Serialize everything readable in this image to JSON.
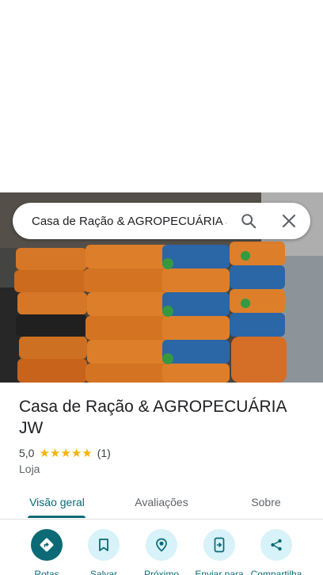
{
  "search": {
    "query": "Casa de Ração & AGROPECUÁRIA JW",
    "search_icon": "search-icon",
    "close_icon": "close-icon"
  },
  "photo": {
    "description_icon": "place-photo"
  },
  "place": {
    "name": "Casa de Ração & AGROPECUÁRIA JW",
    "rating": "5,0",
    "stars": 5,
    "review_count": "(1)",
    "category": "Loja"
  },
  "tabs": [
    {
      "label": "Visão geral",
      "active": true
    },
    {
      "label": "Avaliações",
      "active": false
    },
    {
      "label": "Sobre",
      "active": false
    }
  ],
  "actions": [
    {
      "label": "Rotas",
      "icon": "directions-icon"
    },
    {
      "label": "Salvar",
      "icon": "bookmark-icon"
    },
    {
      "label": "Próximo",
      "icon": "nearby-icon"
    },
    {
      "label": "Enviar para",
      "icon": "send-to-phone-icon"
    },
    {
      "label": "Compartilha",
      "icon": "share-icon"
    }
  ],
  "colors": {
    "accent": "#0b6a76",
    "accent_light": "#d7f2f8",
    "star": "#f5b400"
  }
}
